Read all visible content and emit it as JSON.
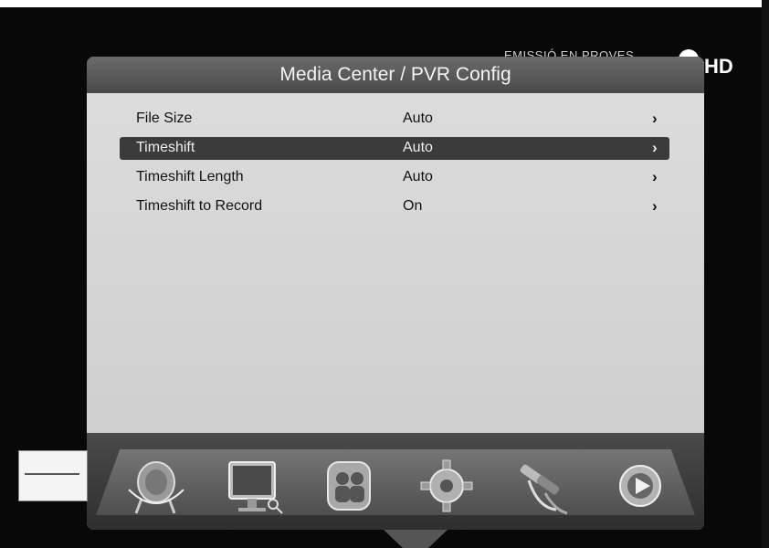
{
  "overlay": {
    "channel_banner": "EMISSIÓ EN PROVES",
    "hd_label": "HD"
  },
  "window": {
    "title": "Media Center / PVR Config"
  },
  "settings": [
    {
      "label": "File Size",
      "value": "Auto",
      "chevron": "›"
    },
    {
      "label": "Timeshift",
      "value": "Auto",
      "chevron": "›"
    },
    {
      "label": "Timeshift Length",
      "value": "Auto",
      "chevron": "›"
    },
    {
      "label": "Timeshift to Record",
      "value": "On",
      "chevron": "›"
    }
  ],
  "dock": {
    "icons": [
      "satellite-dish-icon",
      "tv-monitor-icon",
      "people-icon",
      "settings-gear-icon",
      "cables-icon",
      "media-play-icon"
    ]
  }
}
